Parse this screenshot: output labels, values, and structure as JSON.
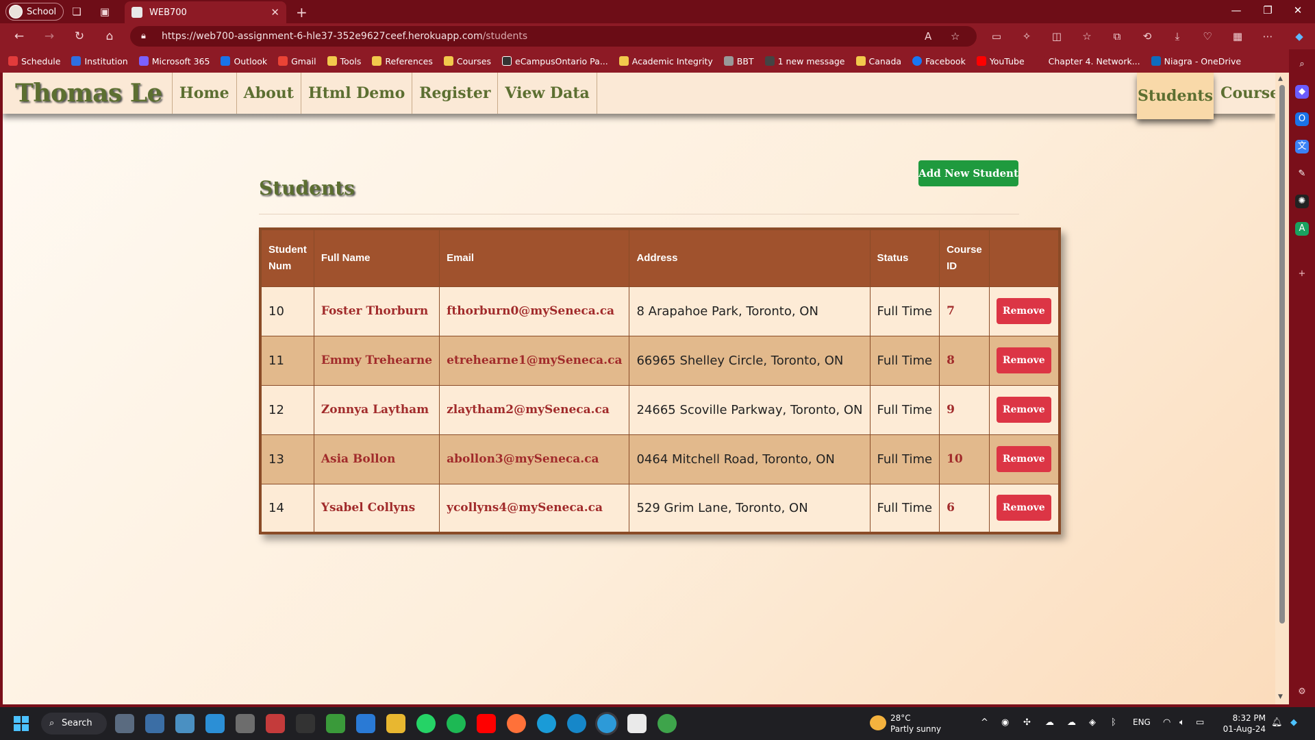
{
  "browser": {
    "profile_label": "School",
    "tab_title": "WEB700",
    "url_base": "https://web700-assignment-6-hle37-352e9627ceef.herokuapp.com",
    "url_path": "/students",
    "bookmarks": [
      {
        "label": "Schedule",
        "color": "#e23b3b"
      },
      {
        "label": "Institution",
        "color": "#2f6fe0"
      },
      {
        "label": "Microsoft 365",
        "color": "#7b61ff"
      },
      {
        "label": "Outlook",
        "color": "#1a73e8"
      },
      {
        "label": "Gmail",
        "color": "#ea4335"
      },
      {
        "label": "Tools",
        "color": "#f2c94c"
      },
      {
        "label": "References",
        "color": "#f2c94c"
      },
      {
        "label": "Courses",
        "color": "#f2c94c"
      },
      {
        "label": "eCampusOntario Pa...",
        "color": "#333333"
      },
      {
        "label": "Academic Integrity",
        "color": "#f2c94c"
      },
      {
        "label": "BBT",
        "color": "#999999"
      },
      {
        "label": "1 new message",
        "color": "#444444"
      },
      {
        "label": "Canada",
        "color": "#f2c94c"
      },
      {
        "label": "Facebook",
        "color": "#1877f2"
      },
      {
        "label": "YouTube",
        "color": "#ff0000"
      },
      {
        "label": "Chapter 4. Network...",
        "color": "#8d1a25"
      },
      {
        "label": "Niagra - OneDrive",
        "color": "#0f6cbd"
      }
    ]
  },
  "site": {
    "brand": "Thomas Le",
    "nav": [
      "Home",
      "About",
      "Html Demo",
      "Register",
      "View Data"
    ],
    "nav_active": "Students",
    "nav_courses": "Courses"
  },
  "page": {
    "title": "Students",
    "add_button": "Add New Student",
    "columns": [
      "Student Num",
      "Full Name",
      "Email",
      "Address",
      "Status",
      "Course ID",
      ""
    ],
    "remove_label": "Remove",
    "rows": [
      {
        "num": "10",
        "name": "Foster Thorburn",
        "email": "fthorburn0@mySeneca.ca",
        "address": "8 Arapahoe Park, Toronto, ON",
        "status": "Full Time",
        "course": "7"
      },
      {
        "num": "11",
        "name": "Emmy Trehearne",
        "email": "etrehearne1@mySeneca.ca",
        "address": "66965 Shelley Circle, Toronto, ON",
        "status": "Full Time",
        "course": "8"
      },
      {
        "num": "12",
        "name": "Zonnya Laytham",
        "email": "zlaytham2@mySeneca.ca",
        "address": "24665 Scoville Parkway, Toronto, ON",
        "status": "Full Time",
        "course": "9"
      },
      {
        "num": "13",
        "name": "Asia Bollon",
        "email": "abollon3@mySeneca.ca",
        "address": "0464 Mitchell Road, Toronto, ON",
        "status": "Full Time",
        "course": "10"
      },
      {
        "num": "14",
        "name": "Ysabel Collyns",
        "email": "ycollyns4@mySeneca.ca",
        "address": "529 Grim Lane, Toronto, ON",
        "status": "Full Time",
        "course": "6"
      }
    ]
  },
  "taskbar": {
    "search_label": "Search",
    "weather_temp": "28°C",
    "weather_desc": "Partly sunny",
    "language": "ENG",
    "time": "8:32 PM",
    "date": "01-Aug-24"
  }
}
